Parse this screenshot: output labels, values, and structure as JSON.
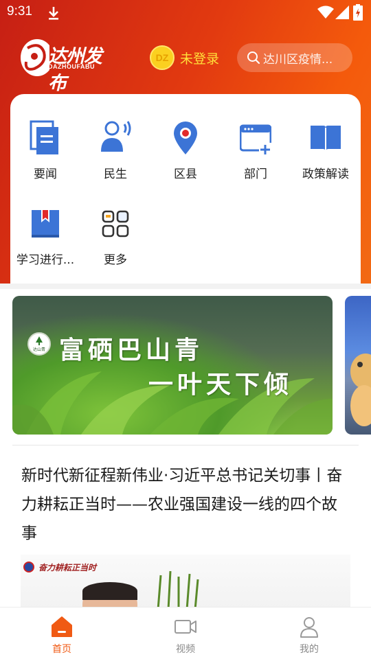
{
  "status_bar": {
    "time": "9:31"
  },
  "header": {
    "logo_text": "达州发布",
    "logo_subtext": "DAZHOUFABU",
    "login_avatar_text": "DZ",
    "login_text": "未登录",
    "search_placeholder": "达川区疫情..."
  },
  "menu": {
    "items": [
      {
        "label": "要闻",
        "icon": "news-icon"
      },
      {
        "label": "民生",
        "icon": "people-speaker-icon"
      },
      {
        "label": "区县",
        "icon": "map-pin-icon"
      },
      {
        "label": "部门",
        "icon": "department-window-icon"
      },
      {
        "label": "政策解读",
        "icon": "book-icon"
      },
      {
        "label": "学习进行...",
        "icon": "bookmark-book-icon"
      },
      {
        "label": "更多",
        "icon": "grid-more-icon"
      }
    ]
  },
  "banner": {
    "badge_text": "达山青",
    "line1": "富硒巴山青",
    "line2": "一叶天下倾"
  },
  "article": {
    "title": "新时代新征程新伟业·习近平总书记关切事丨奋力耕耘正当时——农业强国建设一线的四个故事",
    "image_tag": "奋力耕耘正当时"
  },
  "bottom_nav": {
    "items": [
      {
        "label": "首页",
        "icon": "home-icon",
        "active": true
      },
      {
        "label": "视频",
        "icon": "video-icon",
        "active": false
      },
      {
        "label": "我的",
        "icon": "user-icon",
        "active": false
      }
    ]
  },
  "colors": {
    "brand_red": "#c61f14",
    "brand_orange": "#f45a0c",
    "icon_blue": "#3c74d6",
    "login_yellow": "#ffe13a",
    "nav_active": "#f05a14"
  }
}
